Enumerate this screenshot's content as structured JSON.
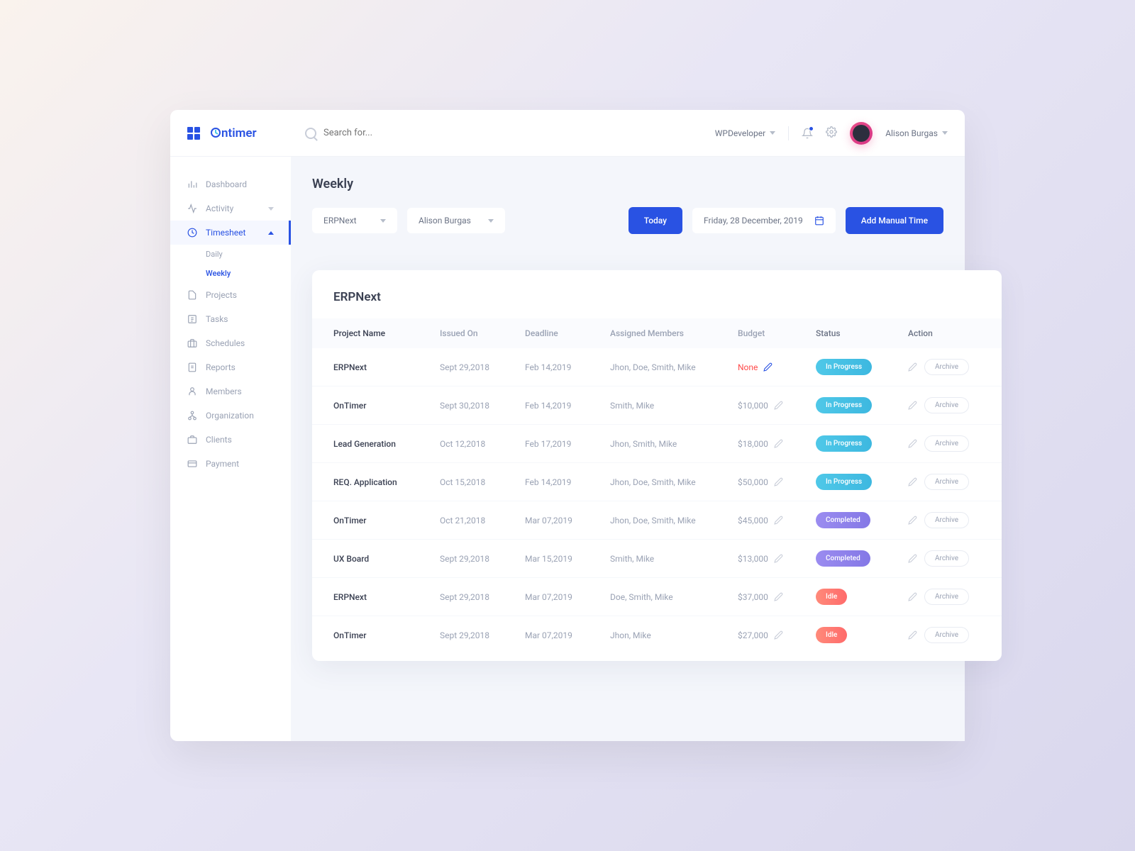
{
  "brand": "ntimer",
  "search": {
    "placeholder": "Search for..."
  },
  "header": {
    "workspace": "WPDeveloper",
    "user": "Alison Burgas"
  },
  "sidebar": {
    "items": [
      {
        "label": "Dashboard"
      },
      {
        "label": "Activity"
      },
      {
        "label": "Timesheet"
      },
      {
        "label": "Projects"
      },
      {
        "label": "Tasks"
      },
      {
        "label": "Schedules"
      },
      {
        "label": "Reports"
      },
      {
        "label": "Members"
      },
      {
        "label": "Organization"
      },
      {
        "label": "Clients"
      },
      {
        "label": "Payment"
      }
    ],
    "timesheet_sub": [
      "Daily",
      "Weekly"
    ]
  },
  "page": {
    "title": "Weekly",
    "filter_project": "ERPNext",
    "filter_user": "Alison Burgas",
    "today_btn": "Today",
    "date": "Friday, 28 December, 2019",
    "add_btn": "Add Manual Time"
  },
  "card": {
    "title": "ERPNext",
    "columns": [
      "Project Name",
      "Issued On",
      "Deadline",
      "Assigned Members",
      "Budget",
      "Status",
      "Action"
    ],
    "archive_label": "Archive",
    "rows": [
      {
        "name": "ERPNext",
        "issued": "Sept 29,2018",
        "deadline": "Feb 14,2019",
        "members": "Jhon, Doe, Smith, Mike",
        "budget": "None",
        "budget_none": true,
        "status": "In Progress",
        "status_class": "progress"
      },
      {
        "name": "OnTimer",
        "issued": "Sept 30,2018",
        "deadline": "Feb 14,2019",
        "members": "Smith, Mike",
        "budget": "$10,000",
        "status": "In Progress",
        "status_class": "progress"
      },
      {
        "name": "Lead Generation",
        "issued": "Oct 12,2018",
        "deadline": "Feb 17,2019",
        "members": "Jhon, Smith, Mike",
        "budget": "$18,000",
        "status": "In Progress",
        "status_class": "progress"
      },
      {
        "name": "REQ. Application",
        "issued": "Oct 15,2018",
        "deadline": "Feb 14,2019",
        "members": "Jhon, Doe, Smith, Mike",
        "budget": "$50,000",
        "status": "In Progress",
        "status_class": "progress"
      },
      {
        "name": "OnTimer",
        "issued": "Oct 21,2018",
        "deadline": "Mar 07,2019",
        "members": "Jhon, Doe, Smith, Mike",
        "budget": "$45,000",
        "status": "Completed",
        "status_class": "completed"
      },
      {
        "name": "UX Board",
        "issued": "Sept 29,2018",
        "deadline": "Mar 15,2019",
        "members": "Smith, Mike",
        "budget": "$13,000",
        "status": "Completed",
        "status_class": "completed"
      },
      {
        "name": "ERPNext",
        "issued": "Sept 29,2018",
        "deadline": "Mar 07,2019",
        "members": "Doe, Smith, Mike",
        "budget": "$37,000",
        "status": "Idle",
        "status_class": "idle"
      },
      {
        "name": "OnTimer",
        "issued": "Sept 29,2018",
        "deadline": "Mar 07,2019",
        "members": "Jhon, Mike",
        "budget": "$27,000",
        "status": "Idle",
        "status_class": "idle"
      }
    ]
  }
}
